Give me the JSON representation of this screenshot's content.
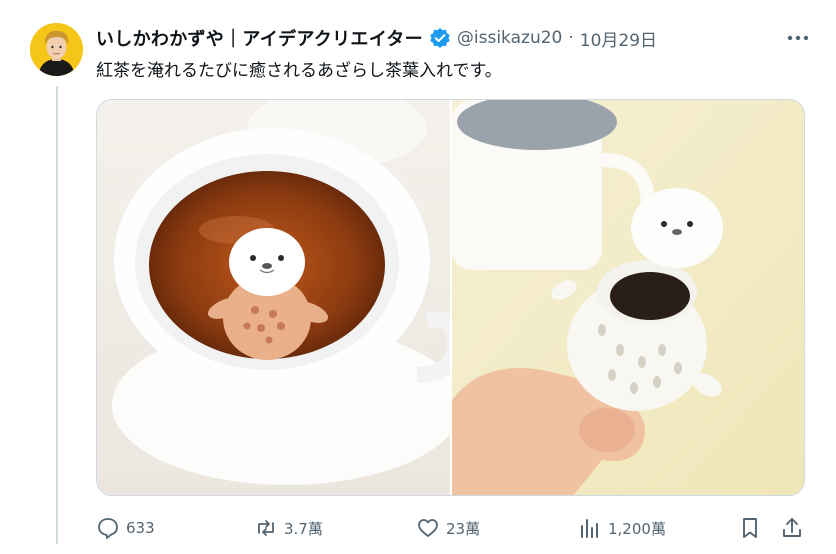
{
  "author": {
    "display_name": "いしかわかずや｜アイデアクリエイター",
    "handle": "@issikazu20",
    "separator": "·",
    "date": "10月29日",
    "verified_color": "#1d9bf0"
  },
  "tweet": {
    "text": "紅茶を淹れるたびに癒されるあざらし茶葉入れです。"
  },
  "media": {
    "images": [
      {
        "icon": "photo-seal-tea-infuser-in-cup"
      },
      {
        "icon": "photo-seal-tea-infuser-in-hand"
      }
    ]
  },
  "actions": {
    "reply_count": "633",
    "retweet_count": "3.7萬",
    "like_count": "23萬",
    "view_count": "1,200萬",
    "icons": [
      "reply-icon",
      "retweet-icon",
      "like-icon",
      "views-icon",
      "bookmark-icon",
      "share-icon"
    ]
  },
  "colors": {
    "text_primary": "#0f1419",
    "text_secondary": "#536471",
    "border": "#cfd9de",
    "avatar_bg": "#f5c518"
  }
}
